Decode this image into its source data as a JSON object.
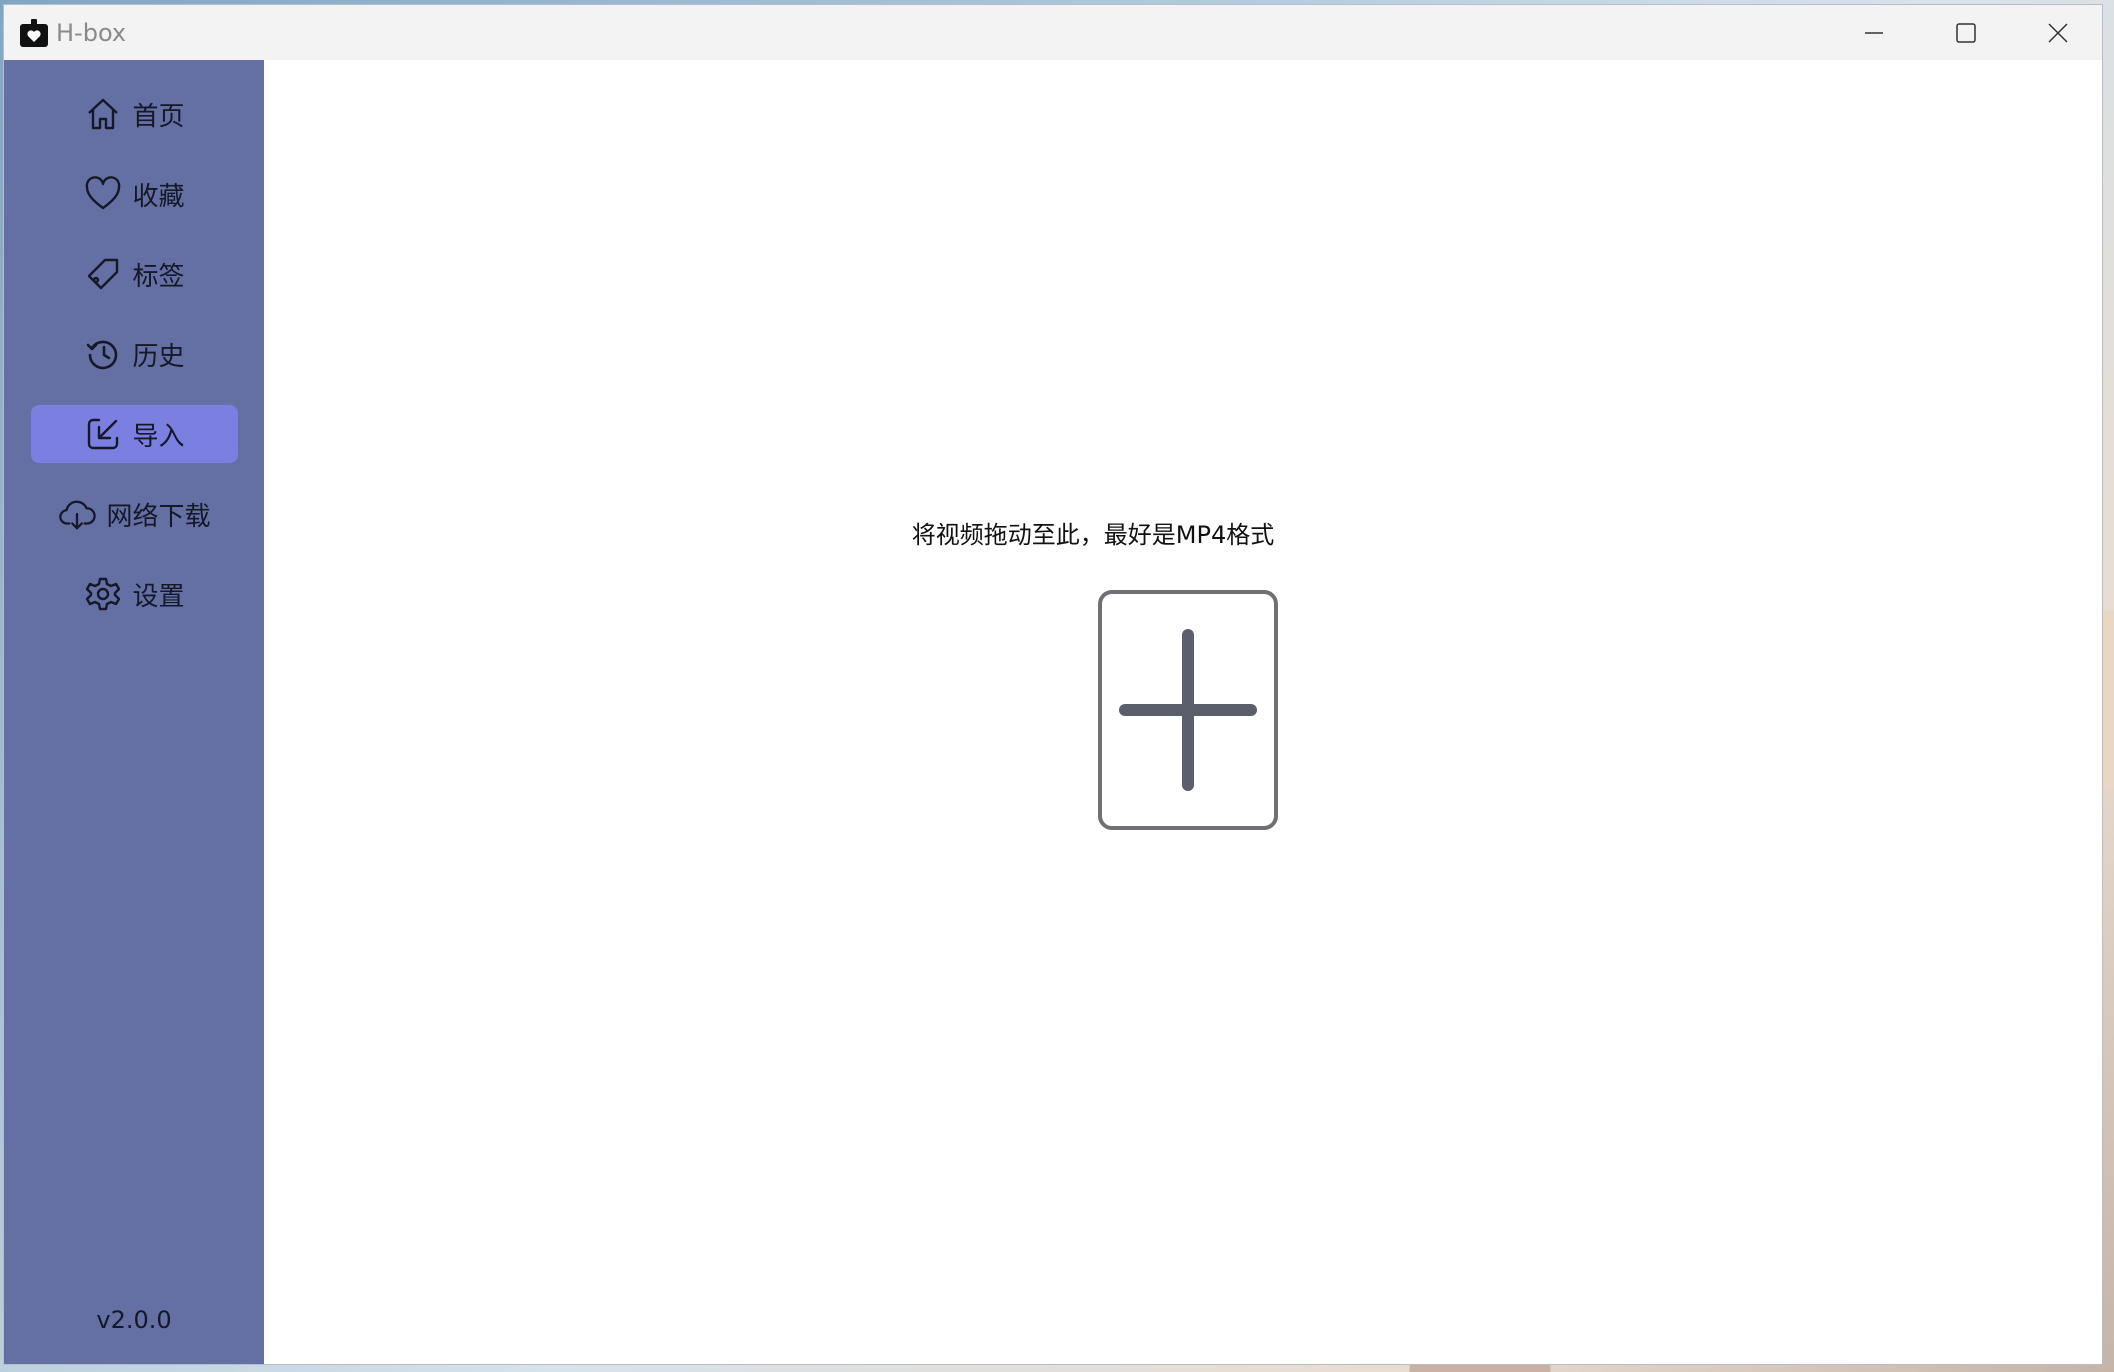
{
  "window": {
    "title": "H-box"
  },
  "sidebar": {
    "items": [
      {
        "label": "首页",
        "icon": "home-icon",
        "active": false
      },
      {
        "label": "收藏",
        "icon": "heart-icon",
        "active": false
      },
      {
        "label": "标签",
        "icon": "tag-icon",
        "active": false
      },
      {
        "label": "历史",
        "icon": "history-icon",
        "active": false
      },
      {
        "label": "导入",
        "icon": "import-icon",
        "active": true
      },
      {
        "label": "网络下载",
        "icon": "cloud-download-icon",
        "active": false
      },
      {
        "label": "设置",
        "icon": "gear-icon",
        "active": false
      }
    ],
    "version": "v2.0.0"
  },
  "main": {
    "hint": "将视频拖动至此，最好是MP4格式",
    "drop_icon": "plus-icon"
  },
  "colors": {
    "sidebar_bg": "#6470a4",
    "active_item_bg": "#7a7fe0",
    "titlebar_bg": "#f3f3f3",
    "plus_color": "#5b5f6b"
  }
}
